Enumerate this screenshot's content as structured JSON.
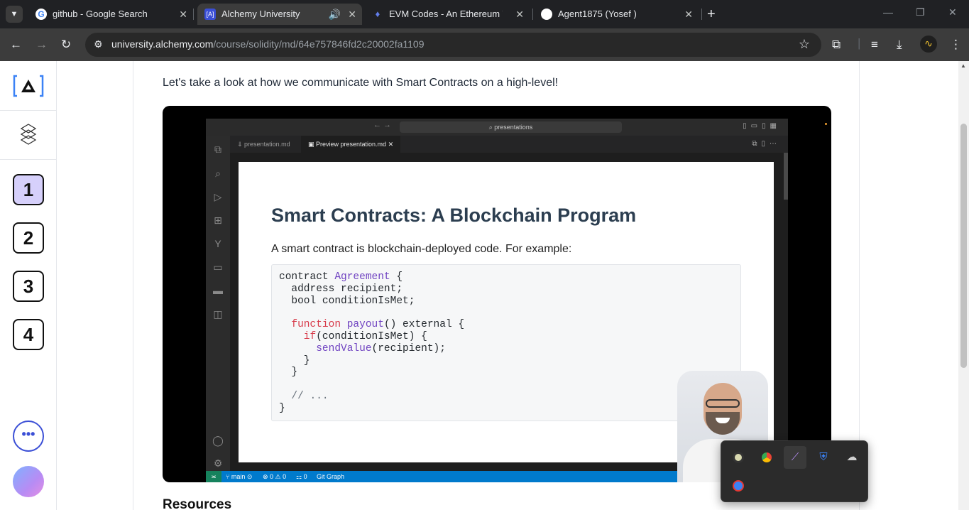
{
  "browser": {
    "tabs": [
      {
        "title": "github - Google Search",
        "favicon": "google-icon"
      },
      {
        "title": "Alchemy University",
        "favicon": "alchemy-icon",
        "active": true,
        "audio": true
      },
      {
        "title": "EVM Codes - An Ethereum Virtu",
        "favicon": "evm-icon"
      },
      {
        "title": "Agent1875 (Yosef )",
        "favicon": "github-icon"
      }
    ],
    "url_domain": "university.alchemy.com",
    "url_path": "/course/solidity/md/64e757846fd2c20002fa1109"
  },
  "sidebar": {
    "lessons": [
      "1",
      "2",
      "3",
      "4"
    ],
    "current_lesson": "1",
    "more_label": "•••"
  },
  "main": {
    "intro": "Let's take a look at how we communicate with Smart Contracts on a high-level!",
    "resources_heading": "Resources"
  },
  "video": {
    "search_text": "presentations",
    "editor_tabs": [
      "presentation.md",
      "Preview presentation.md"
    ],
    "slide_title": "Smart Contracts: A Blockchain Program",
    "slide_subtitle": "A smart contract is blockchain-deployed code. For example:",
    "code": {
      "l1_kw": "contract ",
      "l1_ty": "Agreement",
      "l1_rest": " {",
      "l2": "  address recipient;",
      "l3": "  bool conditionIsMet;",
      "l5_kw": "  function ",
      "l5_ty": "payout",
      "l5_rest": "() external {",
      "l6_kw": "    if",
      "l6_rest": "(conditionIsMet) {",
      "l7_ty": "      sendValue",
      "l7_rest": "(recipient);",
      "l8": "    }",
      "l9": "  }",
      "l11": "  // ...",
      "l12": "}"
    },
    "status": {
      "branch": "main",
      "problems": "⊗ 0 ⚠ 0",
      "ports": "0",
      "git_graph": "Git Graph"
    }
  },
  "tray": {
    "icons": [
      "webcam-app-icon",
      "chrome-icon",
      "feather-app-icon",
      "security-warning-icon",
      "cloud-offline-icon",
      "recorder-icon"
    ]
  },
  "colors": {
    "tabstrip_bg": "#202124",
    "toolbar_bg": "#3c3c3c",
    "current_lesson_bg": "#d6d0fb",
    "statusbar_blue": "#007acc",
    "accent_blue": "#3b4fd6"
  }
}
